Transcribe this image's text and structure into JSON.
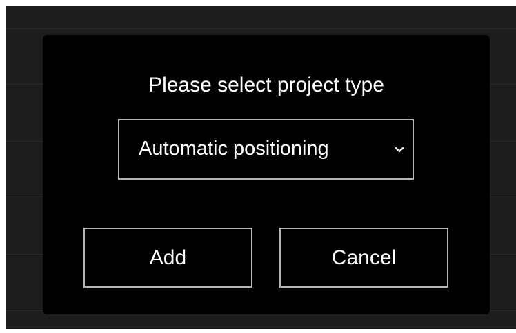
{
  "dialog": {
    "title": "Please select project type",
    "project_type_select": {
      "selected_value": "Automatic positioning",
      "icon": "chevron-down-icon"
    },
    "add_label": "Add",
    "cancel_label": "Cancel"
  },
  "colors": {
    "backdrop": "#1c1c1c",
    "dialog_background": "#000000",
    "border": "#b5b5b5",
    "text": "#ffffff"
  }
}
